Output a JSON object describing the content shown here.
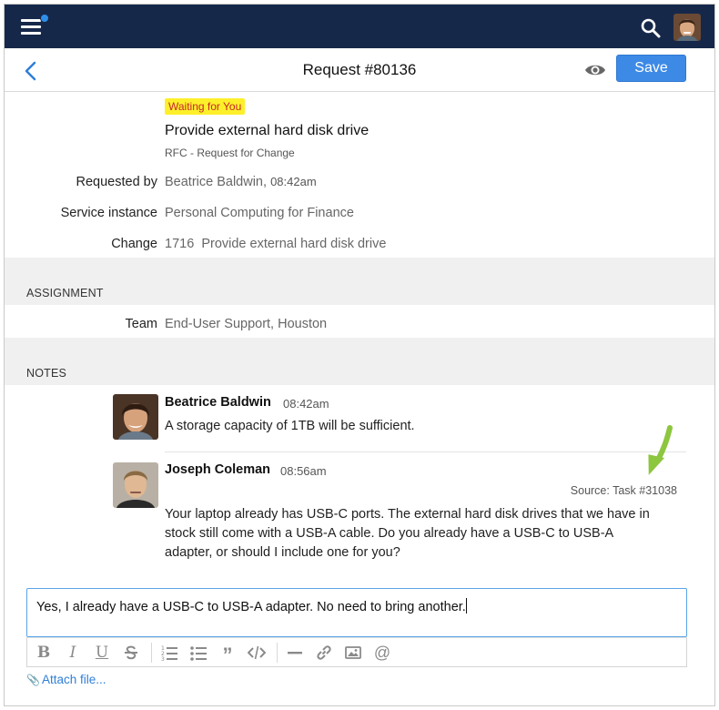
{
  "header": {
    "menu_icon": "hamburger-icon",
    "search_icon": "search-icon"
  },
  "titlebar": {
    "title": "Request #80136",
    "save_label": "Save"
  },
  "request": {
    "status": "Waiting for You",
    "subject": "Provide external hard disk drive",
    "category": "RFC - Request for Change",
    "fields": {
      "requested_by_label": "Requested by",
      "requested_by_value": "Beatrice Baldwin,",
      "requested_by_time": "08:42am",
      "service_instance_label": "Service instance",
      "service_instance_value": "Personal Computing for Finance",
      "change_label": "Change",
      "change_value": "1716  Provide external hard disk drive"
    }
  },
  "assignment": {
    "section_label": "ASSIGNMENT",
    "team_label": "Team",
    "team_value": "End-User Support, Houston"
  },
  "notes": {
    "section_label": "NOTES",
    "items": [
      {
        "author": "Beatrice Baldwin",
        "time": "08:42am",
        "text": "A storage capacity of 1TB will be sufficient."
      },
      {
        "author": "Joseph Coleman",
        "time": "08:56am",
        "source": "Source: Task #31038",
        "text_lines": [
          "Your laptop already has USB-C ports. The external hard disk drives that we have in",
          "stock still come with a USB-A cable. Do you already have a USB-C to USB-A",
          "adapter, or should I include one for you?"
        ]
      }
    ]
  },
  "reply": {
    "value": "Yes, I already have a USB-C to USB-A adapter. No need to bring another.",
    "attach_label": "Attach file..."
  },
  "colors": {
    "appbar": "#16284a",
    "accent": "#3d8ae6",
    "badge_bg": "#fdf02a",
    "badge_text": "#c5262c",
    "arrow": "#8dc63f"
  }
}
